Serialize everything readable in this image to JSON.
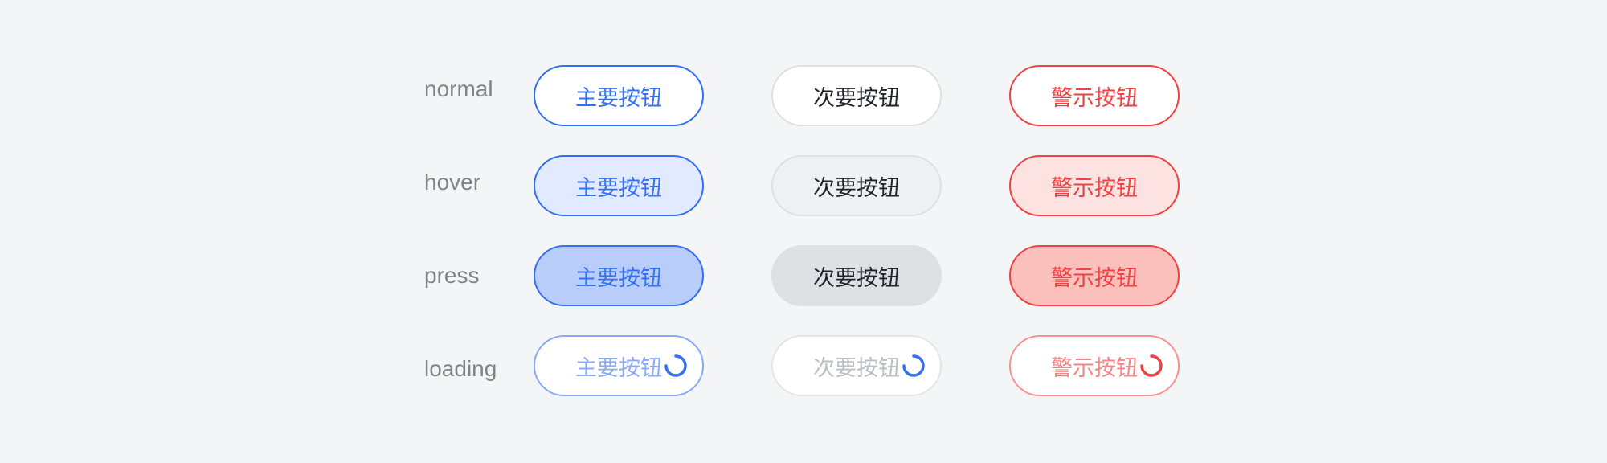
{
  "colors": {
    "primary": "#3370f0",
    "primary_hover_bg": "#e1eafe",
    "primary_press_bg": "#b9cdfb",
    "secondary_text": "#1f2329",
    "secondary_border": "#dfe0e3",
    "danger": "#f14141",
    "danger_hover_bg": "#fde2e2",
    "danger_press_bg": "#fbbfbc",
    "background": "#f4f5f7"
  },
  "states": [
    "normal",
    "hover",
    "press",
    "loading"
  ],
  "buttons": {
    "primary_label": "主要按钮",
    "secondary_label": "次要按钮",
    "danger_label": "警示按钮"
  },
  "icons": {
    "spinner": "loading-spinner-icon"
  }
}
